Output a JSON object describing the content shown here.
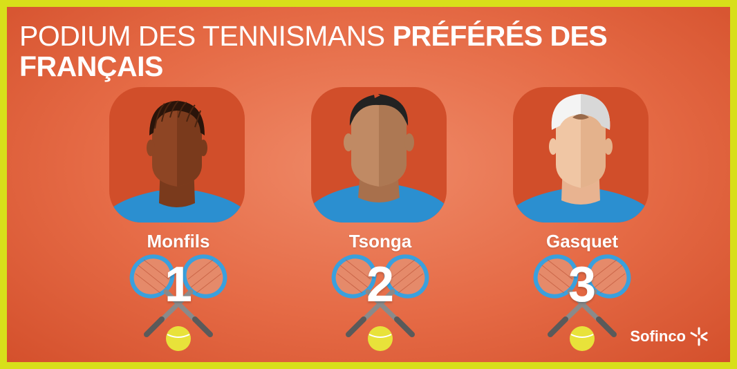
{
  "title": {
    "light": "PODIUM DES TENNISMANS",
    "bold": "PRÉFÉRÉS DES FRANÇAIS"
  },
  "players": [
    {
      "name": "Monfils",
      "rank": "1"
    },
    {
      "name": "Tsonga",
      "rank": "2"
    },
    {
      "name": "Gasquet",
      "rank": "3"
    }
  ],
  "brand": {
    "name": "Sofinco"
  },
  "icons": {
    "racket": "tennis-rackets-icon",
    "ball": "tennis-ball-icon",
    "logo_star": "sofinco-star-icon"
  },
  "colors": {
    "border": "#d8df1a",
    "background": "#e56a45",
    "avatar_bg": "#d14e2a",
    "shirt": "#2b8fd0",
    "racket_frame": "#3aa0dd",
    "ball": "#e8e23a",
    "text": "#ffffff"
  }
}
